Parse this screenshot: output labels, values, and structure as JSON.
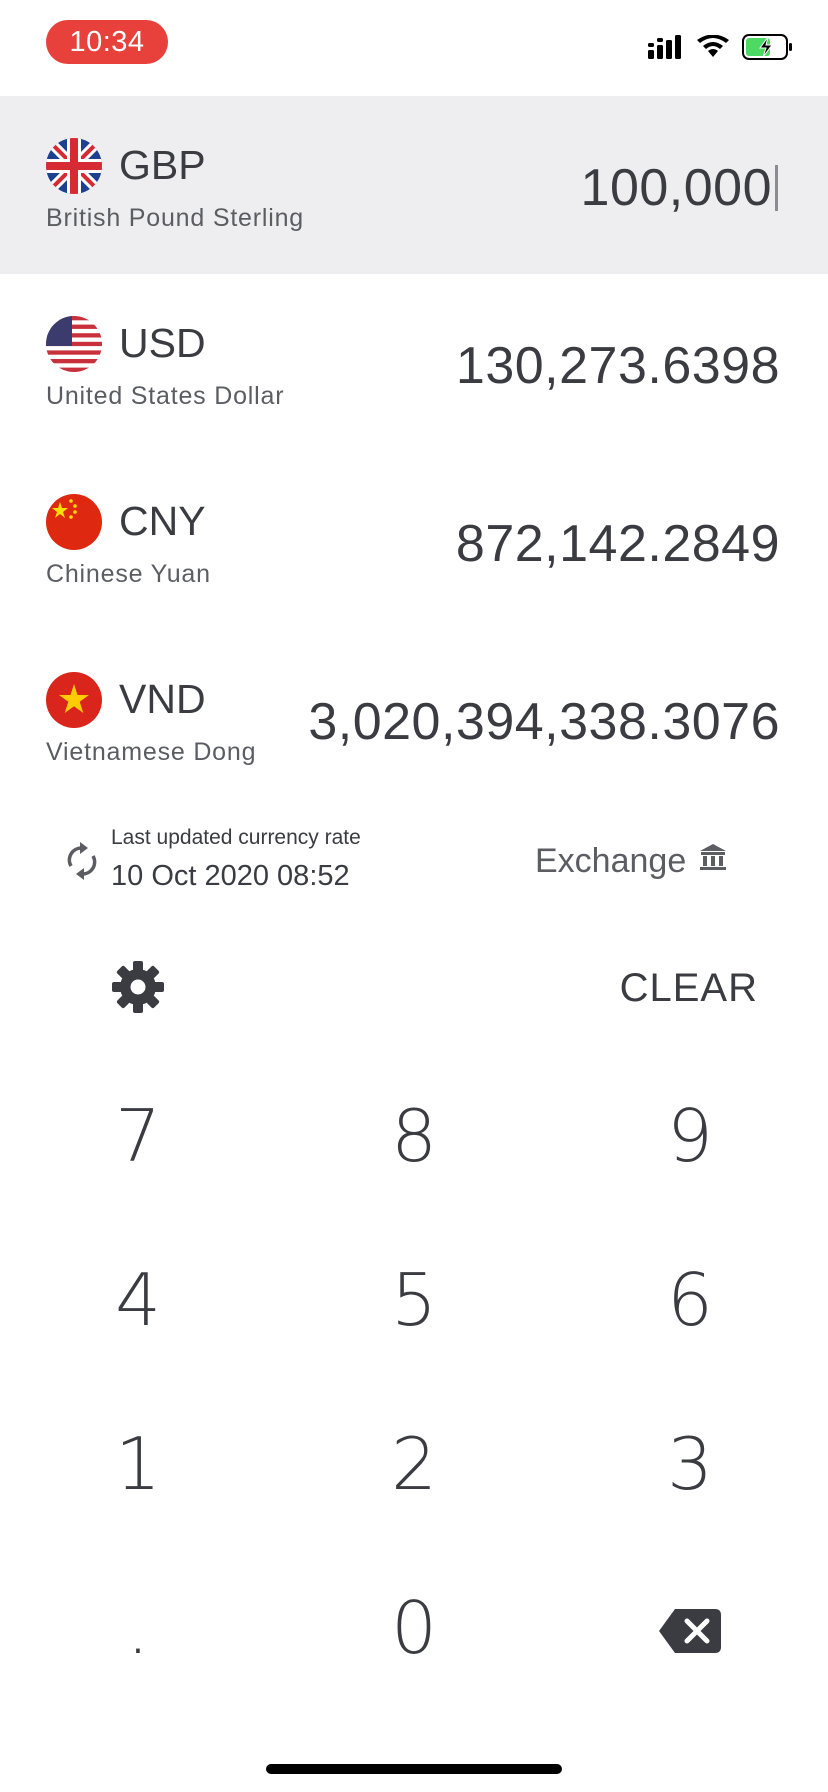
{
  "status_bar": {
    "time": "10:34"
  },
  "currencies": [
    {
      "code": "GBP",
      "name": "British Pound Sterling",
      "amount": "100,000",
      "flag_icon": "uk-flag-icon"
    },
    {
      "code": "USD",
      "name": "United States Dollar",
      "amount": "130,273.6398",
      "flag_icon": "us-flag-icon"
    },
    {
      "code": "CNY",
      "name": "Chinese Yuan",
      "amount": "872,142.2849",
      "flag_icon": "china-flag-icon"
    },
    {
      "code": "VND",
      "name": "Vietnamese Dong",
      "amount": "3,020,394,338.3076",
      "flag_icon": "vietnam-flag-icon"
    }
  ],
  "info": {
    "updated_label": "Last updated currency rate",
    "updated_date": "10 Oct 2020 08:52",
    "exchange_label": "Exchange"
  },
  "toolbar": {
    "clear_label": "CLEAR"
  },
  "keys": [
    "7",
    "8",
    "9",
    "4",
    "5",
    "6",
    "1",
    "2",
    "3",
    ".",
    "0"
  ],
  "colors": {
    "status_pill": "#e8403a",
    "active_row": "#eeeef0",
    "text": "#3a3c42",
    "battery": "#4cd964"
  }
}
